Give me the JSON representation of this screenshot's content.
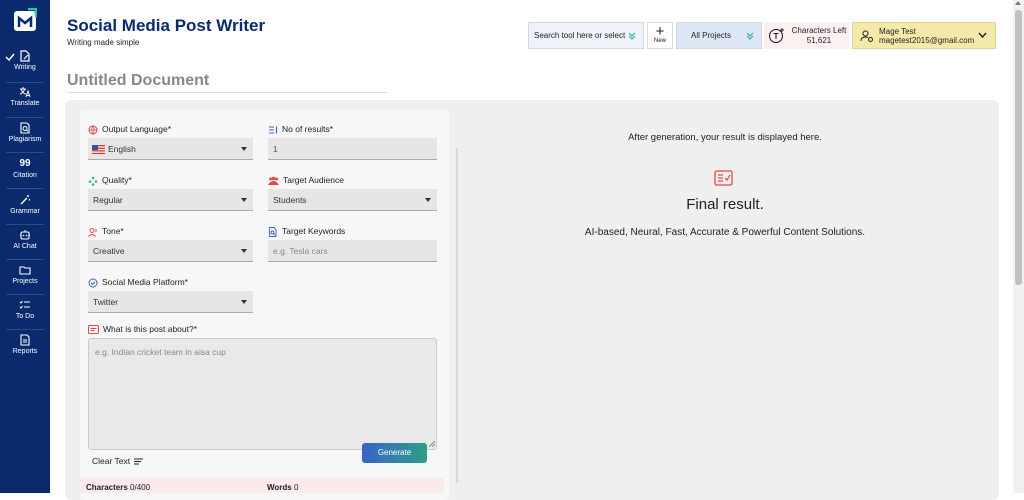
{
  "sidebar": {
    "items": [
      {
        "label": "Writing",
        "icon": "edit-icon",
        "active": true
      },
      {
        "label": "Translate",
        "icon": "translate-icon"
      },
      {
        "label": "Plagiarism",
        "icon": "document-search-icon"
      },
      {
        "label": "Citation",
        "icon": "quote-icon",
        "glyph": "99"
      },
      {
        "label": "Grammar",
        "icon": "magic-wand-icon"
      },
      {
        "label": "AI Chat",
        "icon": "robot-icon"
      },
      {
        "label": "Projects",
        "icon": "folder-icon"
      },
      {
        "label": "To Do",
        "icon": "checklist-icon"
      },
      {
        "label": "Reports",
        "icon": "report-icon"
      }
    ]
  },
  "header": {
    "title": "Social Media Post Writer",
    "subtitle": "Writing made simple",
    "search_placeholder": "Search tool here or select",
    "new_label": "New",
    "projects_label": "All Projects",
    "chars_left_label": "Characters Left",
    "chars_left_value": "51,621",
    "user_name": "Mage Test",
    "user_email": "magetest2015@gmail.com"
  },
  "document": {
    "title": "Untitled Document"
  },
  "form": {
    "output_language": {
      "label": "Output Language*",
      "value": "English"
    },
    "num_results": {
      "label": "No of results*",
      "value": "1"
    },
    "quality": {
      "label": "Quality*",
      "value": "Regular"
    },
    "target_audience": {
      "label": "Target Audience",
      "value": "Students"
    },
    "tone": {
      "label": "Tone*",
      "value": "Creative"
    },
    "target_keywords": {
      "label": "Target Keywords",
      "placeholder": "e.g. Tesla cars"
    },
    "platform": {
      "label": "Social Media Platform*",
      "value": "Twitter"
    },
    "about": {
      "label": "What is this post about?*",
      "placeholder": "e.g. Indian cricket team in aisa cup"
    },
    "generate_label": "Generate",
    "clear_label": "Clear Text",
    "characters_label": "Characters",
    "characters_value": "0/400",
    "words_label": "Words",
    "words_value": "0"
  },
  "result": {
    "info": "After generation, your result is displayed here.",
    "title": "Final result.",
    "description": "AI-based, Neural, Fast, Accurate & Powerful Content Solutions."
  },
  "colors": {
    "sidebar": "#0a2a6e",
    "title": "#0a2a6e",
    "user_bg": "#f3e9a8",
    "chars_bg": "#fdf0f0",
    "accent_red": "#e04848"
  }
}
